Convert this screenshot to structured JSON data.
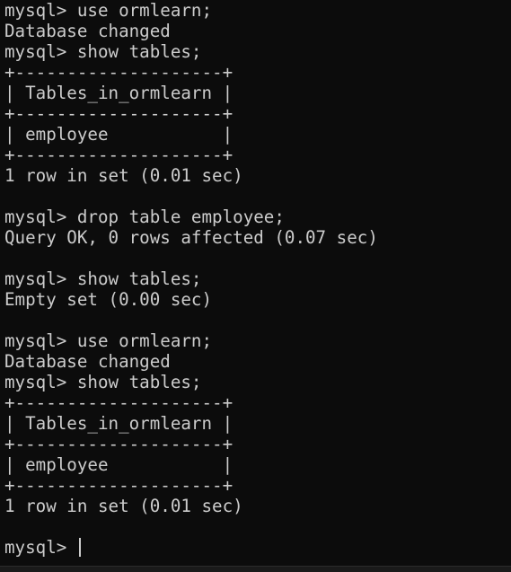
{
  "terminal": {
    "lines": [
      "mysql> use ormlearn;",
      "Database changed",
      "mysql> show tables;",
      "+--------------------+",
      "| Tables_in_ormlearn |",
      "+--------------------+",
      "| employee           |",
      "+--------------------+",
      "1 row in set (0.01 sec)",
      "",
      "mysql> drop table employee;",
      "Query OK, 0 rows affected (0.07 sec)",
      "",
      "mysql> show tables;",
      "Empty set (0.00 sec)",
      "",
      "mysql> use ormlearn;",
      "Database changed",
      "mysql> show tables;",
      "+--------------------+",
      "| Tables_in_ormlearn |",
      "+--------------------+",
      "| employee           |",
      "+--------------------+",
      "1 row in set (0.01 sec)",
      ""
    ],
    "prompt": "mysql> ",
    "colors": {
      "background": "#0c0c0c",
      "foreground": "#cccccc"
    }
  }
}
